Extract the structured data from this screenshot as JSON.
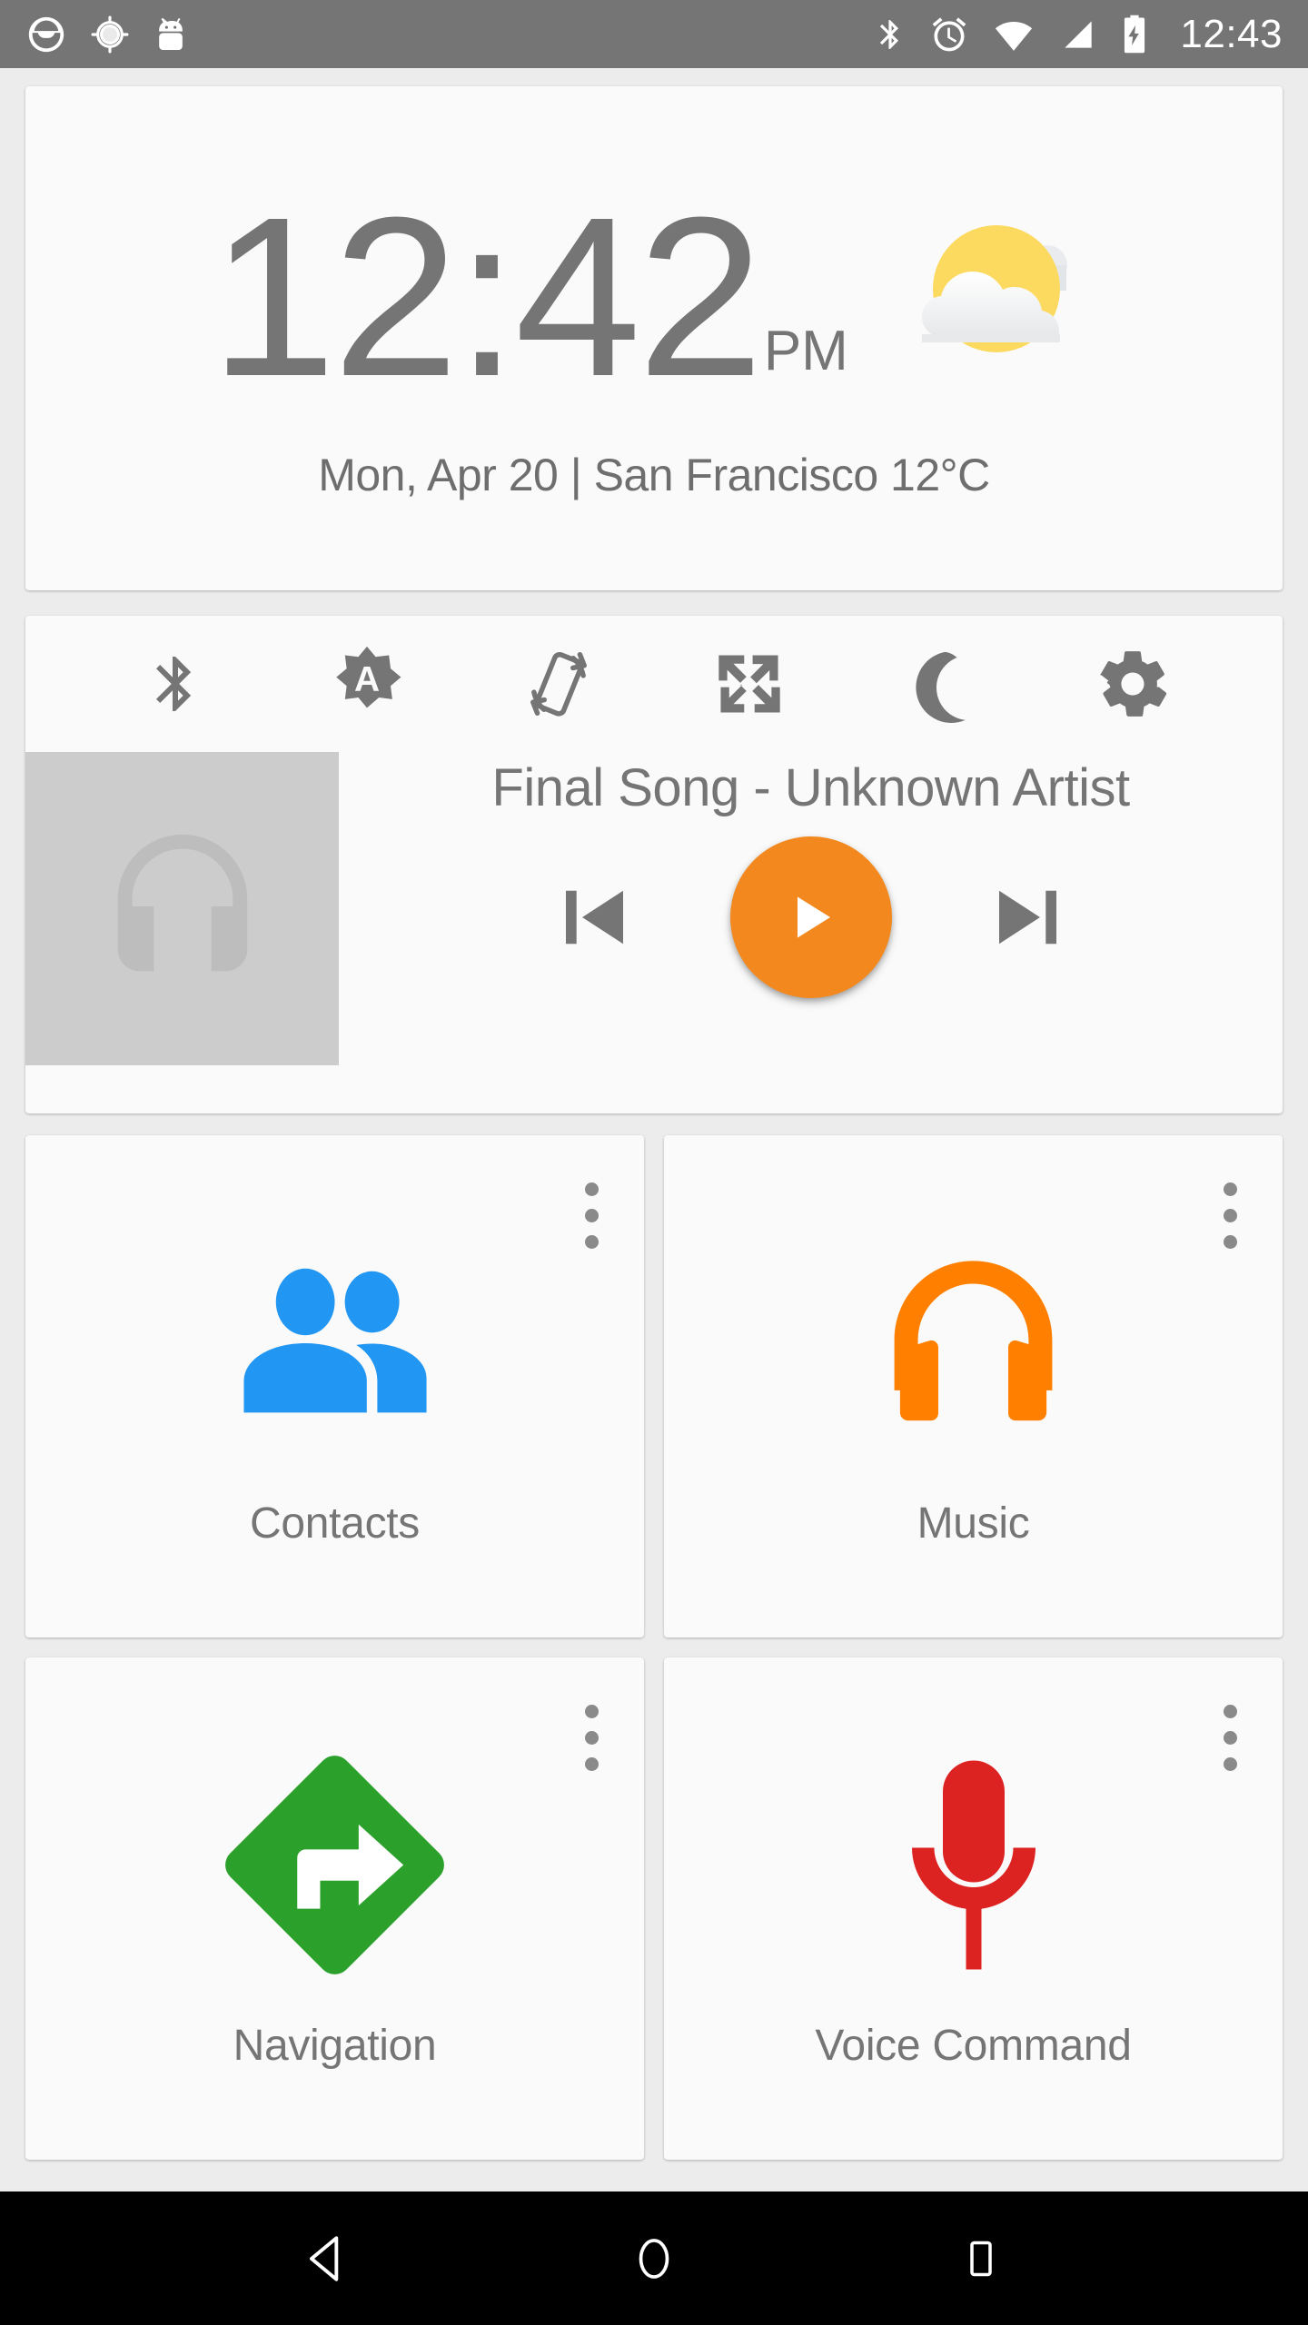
{
  "status_bar": {
    "background_color": "#757575",
    "left_icons": [
      {
        "name": "driving-mode-icon",
        "label": "Driving Mode"
      },
      {
        "name": "location-icon",
        "label": "Location"
      },
      {
        "name": "android-icon",
        "label": "Android System"
      }
    ],
    "right_icons": [
      {
        "name": "bluetooth-icon",
        "label": "Bluetooth"
      },
      {
        "name": "alarm-icon",
        "label": "Alarm Set"
      },
      {
        "name": "wifi-icon",
        "label": "Wi-Fi"
      },
      {
        "name": "cellular-signal-icon",
        "label": "Cellular Signal"
      },
      {
        "name": "battery-charging-icon",
        "label": "Battery Charging"
      }
    ],
    "clock": "12:43"
  },
  "clock_card": {
    "time": "12:42",
    "ampm": "PM",
    "subtitle": "Mon, Apr 20 | San Francisco 12°C",
    "date": "Mon, Apr 20",
    "city": "San Francisco",
    "temperature": "12°C",
    "weather_icon": "partly-cloudy-icon",
    "text_color": "#757575"
  },
  "quick_toggles": [
    {
      "name": "bluetooth-toggle",
      "label": "Bluetooth"
    },
    {
      "name": "auto-brightness-toggle",
      "label": "Auto Brightness",
      "glyph": "A"
    },
    {
      "name": "auto-rotate-toggle",
      "label": "Auto Rotate"
    },
    {
      "name": "fullscreen-toggle",
      "label": "Fullscreen"
    },
    {
      "name": "do-not-disturb-toggle",
      "label": "Do Not Disturb"
    },
    {
      "name": "settings-toggle",
      "label": "Settings"
    }
  ],
  "media_player": {
    "track_title": "Final Song - Unknown Artist",
    "song": "Final Song",
    "artist": "Unknown Artist",
    "album_art_icon": "headphones-placeholder-icon",
    "album_art_color": "#cccccc",
    "play_state": "paused",
    "play_button_color": "#f3891e",
    "controls": [
      {
        "name": "previous-track-button",
        "label": "Previous"
      },
      {
        "name": "play-button",
        "label": "Play"
      },
      {
        "name": "next-track-button",
        "label": "Next"
      }
    ]
  },
  "app_tiles": [
    {
      "name": "contacts",
      "label": "Contacts",
      "icon": "people-icon",
      "color": "#2196f3",
      "menu": "overflow-menu"
    },
    {
      "name": "music",
      "label": "Music",
      "icon": "headphones-icon",
      "color": "#ff8000",
      "menu": "overflow-menu"
    },
    {
      "name": "navigation",
      "label": "Navigation",
      "icon": "turn-right-diamond-icon",
      "color": "#2ba12b",
      "menu": "overflow-menu"
    },
    {
      "name": "voice-command",
      "label": "Voice Command",
      "icon": "microphone-icon",
      "color": "#dd2222",
      "menu": "overflow-menu"
    }
  ],
  "nav_bar": {
    "background_color": "#000000",
    "buttons": [
      {
        "name": "back-button",
        "label": "Back"
      },
      {
        "name": "home-button",
        "label": "Home"
      },
      {
        "name": "recents-button",
        "label": "Recent Apps"
      }
    ]
  },
  "theme": {
    "page_background": "#ececec",
    "card_background": "#fafafa",
    "primary_text": "#757575",
    "accent": "#f3891e"
  }
}
